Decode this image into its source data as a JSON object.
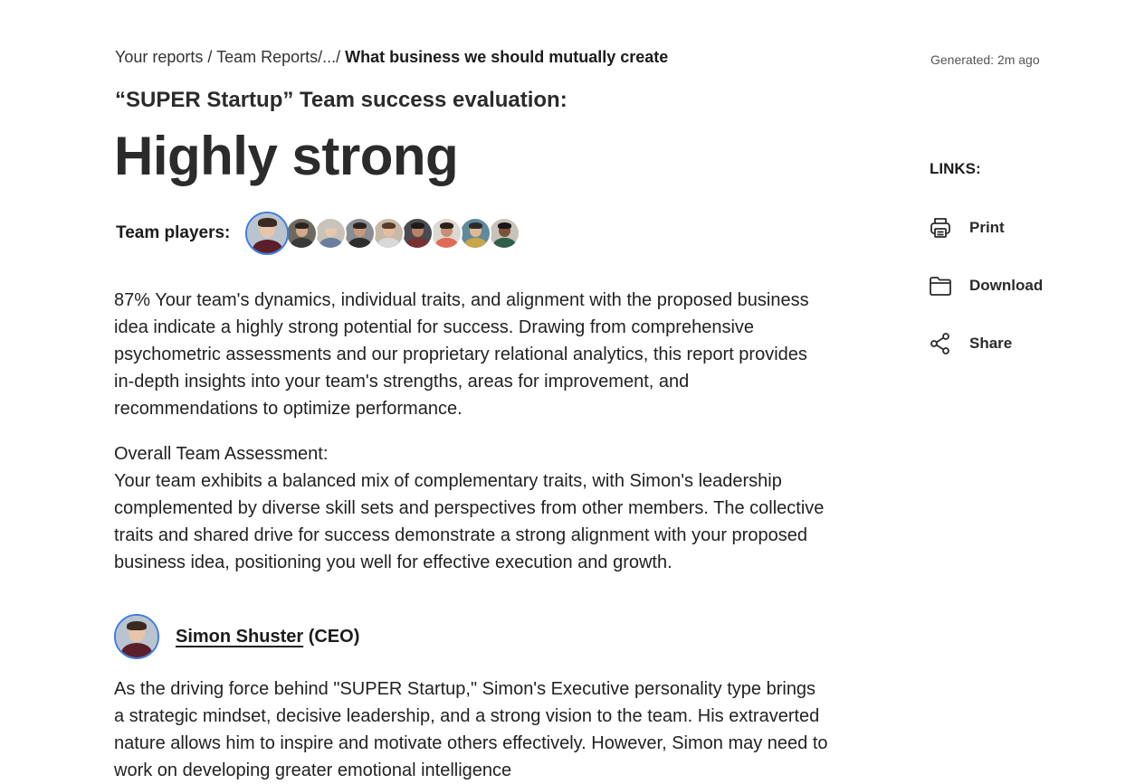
{
  "breadcrumb": {
    "item1": "Your reports",
    "sep1": " / ",
    "item2": "Team Reports/",
    "ellipsis": "...",
    "sep2": "/ ",
    "current": "What business we should mutually create"
  },
  "generated": "Generated: 2m ago",
  "report": {
    "evaluation_label": "“SUPER Startup” Team success evaluation:",
    "headline": "Highly strong",
    "players_label": "Team players:",
    "players": [
      {
        "name": "team-player-1",
        "skin": "#e8c4a8",
        "hair": "#3a2a22",
        "shirt": "#5a1f2a",
        "bg": "#b9c4cf"
      },
      {
        "name": "team-player-2",
        "skin": "#d6a98a",
        "hair": "#2c2420",
        "shirt": "#3a3a3a",
        "bg": "#6d6a60"
      },
      {
        "name": "team-player-3",
        "skin": "#e9c9ae",
        "hair": "#c9c4bd",
        "shirt": "#6a7fa0",
        "bg": "#c8c2b8"
      },
      {
        "name": "team-player-4",
        "skin": "#c89a7c",
        "hair": "#2a2420",
        "shirt": "#2e2e2e",
        "bg": "#8a8d92"
      },
      {
        "name": "team-player-5",
        "skin": "#e3bfa0",
        "hair": "#5a3a28",
        "shirt": "#d8d8d8",
        "bg": "#c6b9a8"
      },
      {
        "name": "team-player-6",
        "skin": "#b98466",
        "hair": "#1e1a18",
        "shirt": "#7a3030",
        "bg": "#4a4a50"
      },
      {
        "name": "team-player-7",
        "skin": "#c48f72",
        "hair": "#2a201c",
        "shirt": "#e06c55",
        "bg": "#dcd8d2"
      },
      {
        "name": "team-player-8",
        "skin": "#e1b892",
        "hair": "#2f2a28",
        "shirt": "#c9a54a",
        "bg": "#5e8a9a"
      },
      {
        "name": "team-player-9",
        "skin": "#7a5238",
        "hair": "#1a1614",
        "shirt": "#2f5e4a",
        "bg": "#c8c3ba"
      }
    ],
    "summary": "87% Your team's dynamics, individual traits, and alignment with the proposed business idea indicate a highly strong potential for success. Drawing from comprehensive psychometric assessments and our proprietary relational analytics, this report provides in-depth insights into your team's strengths, areas for improvement, and recommendations to optimize performance.",
    "assessment_heading": "Overall Team Assessment:",
    "assessment_body": "Your team exhibits a balanced mix of complementary traits, with Simon's leadership complemented by diverse skill sets and perspectives from other members. The collective traits and shared drive for success demonstrate a strong alignment with your proposed business idea, positioning you well for effective execution and growth.",
    "member": {
      "name": "Simon Shuster",
      "role": " (CEO)",
      "description": "As the driving force behind \"SUPER Startup,\" Simon's Executive personality type brings a strategic mindset, decisive leadership, and a strong vision to the team. His extraverted nature allows him to inspire and motivate others effectively. However, Simon may need to work on developing greater emotional intelligence"
    }
  },
  "links": {
    "title": "LINKS:",
    "print": "Print",
    "download": "Download",
    "share": "Share"
  }
}
